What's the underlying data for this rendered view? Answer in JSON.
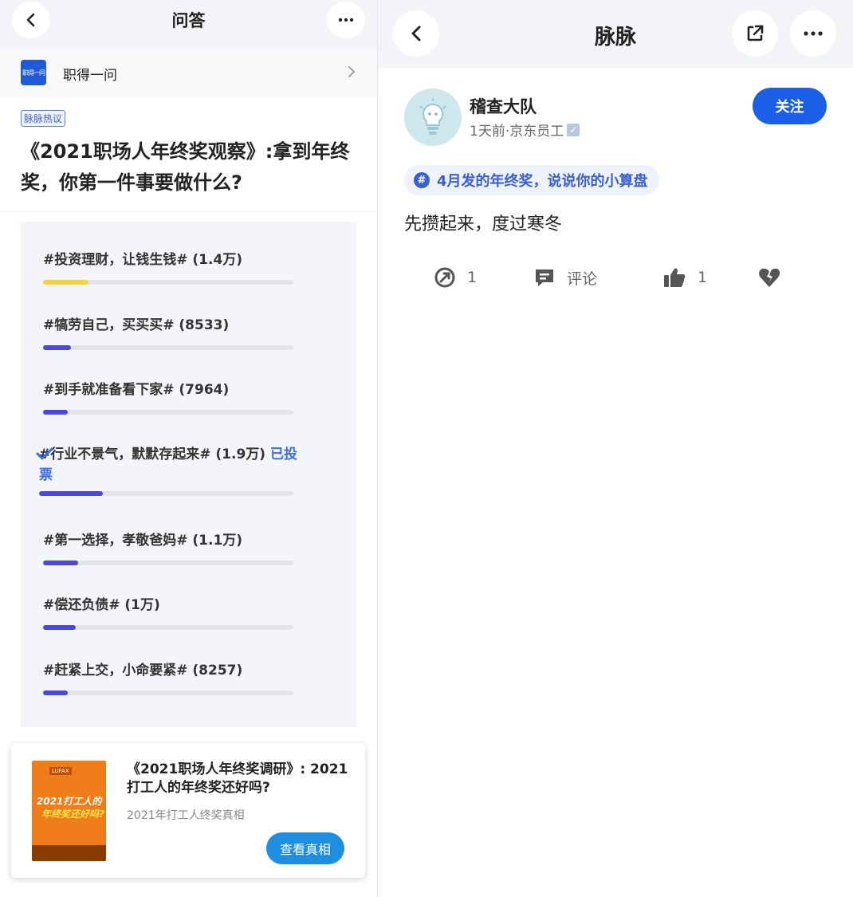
{
  "left": {
    "header": {
      "title": "问答",
      "back_icon": "chevron-left-icon",
      "more_icon": "more-dots-icon"
    },
    "source": {
      "logo_text": "职得一问",
      "name": "职得一问"
    },
    "tag": "脉脉热议",
    "question": "《2021职场人年终奖观察》:拿到年终奖，你第一件事要做什么?",
    "poll": {
      "options": [
        {
          "label": "#投资理财，让钱生钱# (1.4万)",
          "percent": 18,
          "color": "#f5d33a",
          "voted": false,
          "voted_text": ""
        },
        {
          "label": "#犒劳自己，买买买# (8533)",
          "percent": 11,
          "color": "#4a48e0",
          "voted": false,
          "voted_text": ""
        },
        {
          "label": "#到手就准备看下家# (7964)",
          "percent": 10,
          "color": "#4a48e0",
          "voted": false,
          "voted_text": ""
        },
        {
          "label": "#行业不景气，默默存起来# (1.9万)",
          "percent": 25,
          "color": "#4a48e0",
          "voted": true,
          "voted_text": "已投票"
        },
        {
          "label": "#第一选择，孝敬爸妈# (1.1万)",
          "percent": 14,
          "color": "#4a48e0",
          "voted": false,
          "voted_text": ""
        },
        {
          "label": "#偿还负债# (1万)",
          "percent": 13,
          "color": "#4a48e0",
          "voted": false,
          "voted_text": ""
        },
        {
          "label": "#赶紧上交，小命要紧# (8257)",
          "percent": 10,
          "color": "#4a48e0",
          "voted": false,
          "voted_text": ""
        }
      ]
    },
    "promo": {
      "cover_brand": "LUFAX",
      "cover_title_1": "2021打工人的",
      "cover_title_2": "年终奖还好吗?",
      "title": "《2021职场人年终奖调研》: 2021打工人的年终奖还好吗?",
      "subtitle": "2021年打工人终奖真相",
      "button": "查看真相"
    }
  },
  "right": {
    "header": {
      "title": "脉脉",
      "back_icon": "chevron-left-icon",
      "share_icon": "share-icon",
      "more_icon": "more-dots-icon"
    },
    "author": {
      "name": "稽查大队",
      "meta": "1天前·京东员工",
      "avatar_icon": "lightbulb-avatar-icon"
    },
    "follow_button": "关注",
    "topic": "4月发的年终奖，说说你的小算盘",
    "body": "先攒起来，度过寒冬",
    "actions": {
      "forward_count": "1",
      "comment_label": "评论",
      "like_count": "1"
    }
  }
}
